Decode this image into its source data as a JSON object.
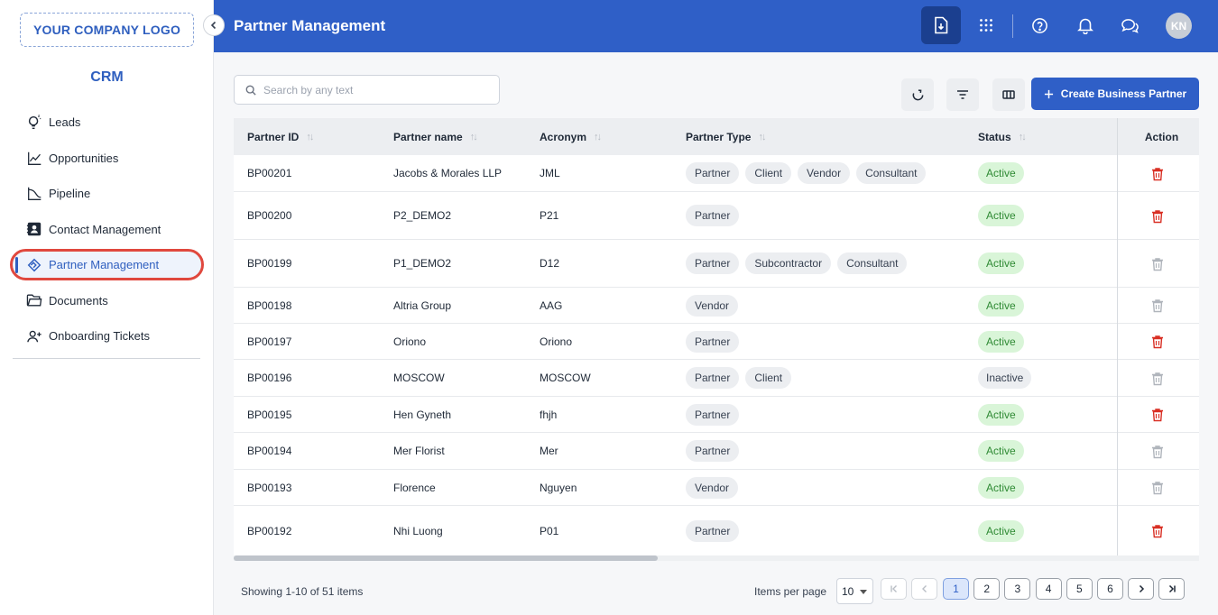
{
  "sidebar": {
    "logo": "YOUR COMPANY LOGO",
    "app_name": "CRM",
    "items": [
      {
        "label": "Leads",
        "icon": "lightbulb-icon"
      },
      {
        "label": "Opportunities",
        "icon": "trend-chart-icon"
      },
      {
        "label": "Pipeline",
        "icon": "pipeline-chart-icon"
      },
      {
        "label": "Contact Management",
        "icon": "contact-book-icon"
      },
      {
        "label": "Partner Management",
        "icon": "handshake-icon",
        "active": true
      },
      {
        "label": "Documents",
        "icon": "folder-icon"
      },
      {
        "label": "Onboarding Tickets",
        "icon": "person-add-icon"
      }
    ]
  },
  "header": {
    "title": "Partner Management",
    "avatar_initials": "KN",
    "icons": [
      "download-file-icon",
      "apps-grid-icon",
      "help-icon",
      "bell-icon",
      "chat-icon"
    ]
  },
  "toolbar": {
    "search_placeholder": "Search by any text",
    "create_label": "Create Business Partner"
  },
  "table": {
    "columns": [
      "Partner ID",
      "Partner name",
      "Acronym",
      "Partner Type",
      "Status",
      "Action"
    ],
    "rows": [
      {
        "id": "BP00201",
        "name": "Jacobs & Morales LLP",
        "acronym": "JML",
        "types": [
          "Partner",
          "Client",
          "Vendor",
          "Consultant"
        ],
        "status": "Active",
        "delete_enabled": true
      },
      {
        "id": "BP00200",
        "name": "P2_DEMO2",
        "acronym": "P21",
        "types": [
          "Partner"
        ],
        "status": "Active",
        "delete_enabled": true
      },
      {
        "id": "BP00199",
        "name": "P1_DEMO2",
        "acronym": "D12",
        "types": [
          "Partner",
          "Subcontractor",
          "Consultant"
        ],
        "status": "Active",
        "delete_enabled": false
      },
      {
        "id": "BP00198",
        "name": "Altria Group",
        "acronym": "AAG",
        "types": [
          "Vendor"
        ],
        "status": "Active",
        "delete_enabled": false
      },
      {
        "id": "BP00197",
        "name": "Oriono",
        "acronym": "Oriono",
        "types": [
          "Partner"
        ],
        "status": "Active",
        "delete_enabled": true
      },
      {
        "id": "BP00196",
        "name": "MOSCOW",
        "acronym": "MOSCOW",
        "types": [
          "Partner",
          "Client"
        ],
        "status": "Inactive",
        "delete_enabled": false
      },
      {
        "id": "BP00195",
        "name": "Hen Gyneth",
        "acronym": "fhjh",
        "types": [
          "Partner"
        ],
        "status": "Active",
        "delete_enabled": true
      },
      {
        "id": "BP00194",
        "name": "Mer Florist",
        "acronym": "Mer",
        "types": [
          "Partner"
        ],
        "status": "Active",
        "delete_enabled": false
      },
      {
        "id": "BP00193",
        "name": "Florence",
        "acronym": "Nguyen",
        "types": [
          "Vendor"
        ],
        "status": "Active",
        "delete_enabled": false
      },
      {
        "id": "BP00192",
        "name": "Nhi Luong",
        "acronym": "P01",
        "types": [
          "Partner"
        ],
        "status": "Active",
        "delete_enabled": true
      }
    ]
  },
  "footer": {
    "showing": "Showing 1-10 of 51 items",
    "items_per_page_label": "Items per page",
    "items_per_page_value": "10",
    "pages": [
      "1",
      "2",
      "3",
      "4",
      "5",
      "6"
    ],
    "current_page": "1"
  },
  "colors": {
    "brand": "#2f5fc7",
    "active_status_bg": "#d9f5d8",
    "active_status_text": "#2f8a34",
    "delete_enabled": "#d93025",
    "delete_disabled": "#b0b5bc",
    "highlight_ring": "#e0483e"
  }
}
